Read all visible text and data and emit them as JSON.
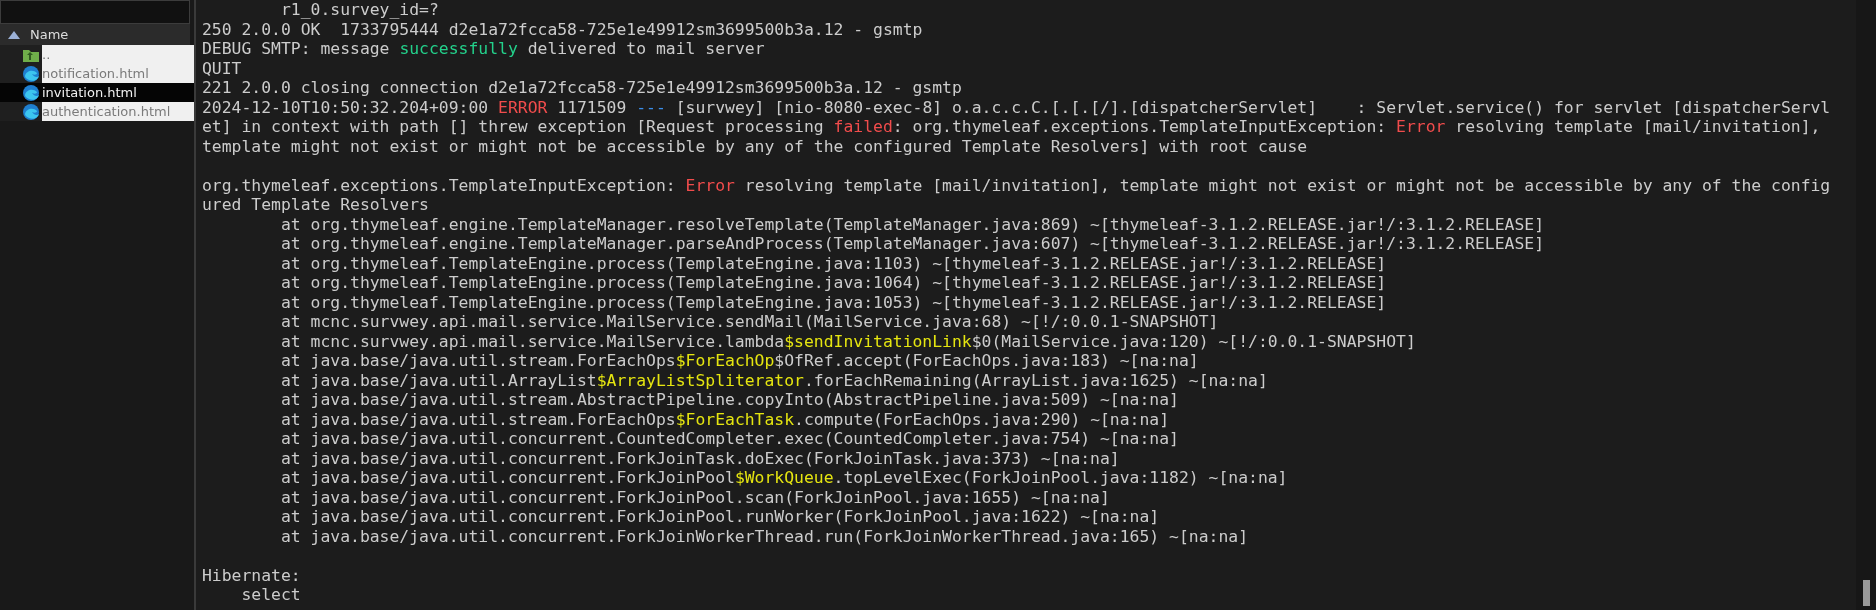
{
  "file_panel": {
    "column_header": "Name",
    "sort_ascending": true,
    "rows": [
      {
        "name": "..",
        "kind": "parent",
        "selected": false,
        "masked": true
      },
      {
        "name": "notification.html",
        "kind": "html",
        "selected": false,
        "masked": true
      },
      {
        "name": "invitation.html",
        "kind": "html",
        "selected": true,
        "masked": false
      },
      {
        "name": "authentication.html",
        "kind": "html",
        "selected": false,
        "masked": true
      }
    ]
  },
  "console": {
    "lines": [
      {
        "segments": [
          {
            "text": "        r1_0.survey_id=?",
            "kind": "plain"
          }
        ]
      },
      {
        "segments": [
          {
            "text": "250 2.0.0 OK  1733795444 d2e1a72fcca58-725e1e49912sm3699500b3a.12 - gsmtp",
            "kind": "plain"
          }
        ]
      },
      {
        "segments": [
          {
            "text": "DEBUG SMTP: message ",
            "kind": "plain"
          },
          {
            "text": "successfully",
            "kind": "success"
          },
          {
            "text": " delivered to mail server",
            "kind": "plain"
          }
        ]
      },
      {
        "segments": [
          {
            "text": "QUIT",
            "kind": "plain"
          }
        ]
      },
      {
        "segments": [
          {
            "text": "221 2.0.0 closing connection d2e1a72fcca58-725e1e49912sm3699500b3a.12 - gsmtp",
            "kind": "plain"
          }
        ]
      },
      {
        "segments": [
          {
            "text": "2024-12-10T10:50:32.204+09:00 ",
            "kind": "plain"
          },
          {
            "text": "ERROR",
            "kind": "error"
          },
          {
            "text": " 1171509 ",
            "kind": "plain"
          },
          {
            "text": "---",
            "kind": "muted"
          },
          {
            "text": " [survwey] [nio-8080-exec-8] o.a.c.c.C.[.[.[/].[dispatcherServlet]    : Servlet.service() for servlet [dispatcherServl",
            "kind": "plain"
          }
        ]
      },
      {
        "segments": [
          {
            "text": "et] in context with path [] threw exception [Request processing ",
            "kind": "plain"
          },
          {
            "text": "failed",
            "kind": "error"
          },
          {
            "text": ": org.thymeleaf.exceptions.TemplateInputException: ",
            "kind": "plain"
          },
          {
            "text": "Error",
            "kind": "error"
          },
          {
            "text": " resolving template [mail/invitation],",
            "kind": "plain"
          }
        ]
      },
      {
        "segments": [
          {
            "text": "template might not exist or might not be accessible by any of the configured Template Resolvers] with root cause",
            "kind": "plain"
          }
        ]
      },
      {
        "space_before": true,
        "segments": [
          {
            "text": "org.thymeleaf.exceptions.TemplateInputException: ",
            "kind": "plain"
          },
          {
            "text": "Error",
            "kind": "error"
          },
          {
            "text": " resolving template [mail/invitation], template might not exist or might not be accessible by any of the config",
            "kind": "plain"
          }
        ]
      },
      {
        "segments": [
          {
            "text": "ured Template Resolvers",
            "kind": "plain"
          }
        ]
      },
      {
        "segments": [
          {
            "text": "        at org.thymeleaf.engine.TemplateManager.resolveTemplate(TemplateManager.java:869) ~[thymeleaf-3.1.2.RELEASE.jar!/:3.1.2.RELEASE]",
            "kind": "plain"
          }
        ]
      },
      {
        "segments": [
          {
            "text": "        at org.thymeleaf.engine.TemplateManager.parseAndProcess(TemplateManager.java:607) ~[thymeleaf-3.1.2.RELEASE.jar!/:3.1.2.RELEASE]",
            "kind": "plain"
          }
        ]
      },
      {
        "segments": [
          {
            "text": "        at org.thymeleaf.TemplateEngine.process(TemplateEngine.java:1103) ~[thymeleaf-3.1.2.RELEASE.jar!/:3.1.2.RELEASE]",
            "kind": "plain"
          }
        ]
      },
      {
        "segments": [
          {
            "text": "        at org.thymeleaf.TemplateEngine.process(TemplateEngine.java:1064) ~[thymeleaf-3.1.2.RELEASE.jar!/:3.1.2.RELEASE]",
            "kind": "plain"
          }
        ]
      },
      {
        "segments": [
          {
            "text": "        at org.thymeleaf.TemplateEngine.process(TemplateEngine.java:1053) ~[thymeleaf-3.1.2.RELEASE.jar!/:3.1.2.RELEASE]",
            "kind": "plain"
          }
        ]
      },
      {
        "segments": [
          {
            "text": "        at mcnc.survwey.api.mail.service.MailService.sendMail(MailService.java:68) ~[!/:0.0.1-SNAPSHOT]",
            "kind": "plain"
          }
        ]
      },
      {
        "segments": [
          {
            "text": "        at mcnc.survwey.api.mail.service.MailService.lambda",
            "kind": "plain"
          },
          {
            "text": "$sendInvitationLink",
            "kind": "highlight"
          },
          {
            "text": "$0(MailService.java:120) ~[!/:0.0.1-SNAPSHOT]",
            "kind": "plain"
          }
        ]
      },
      {
        "segments": [
          {
            "text": "        at java.base/java.util.stream.ForEachOps",
            "kind": "plain"
          },
          {
            "text": "$ForEachOp",
            "kind": "highlight"
          },
          {
            "text": "$OfRef.accept(ForEachOps.java:183) ~[na:na]",
            "kind": "plain"
          }
        ]
      },
      {
        "segments": [
          {
            "text": "        at java.base/java.util.ArrayList",
            "kind": "plain"
          },
          {
            "text": "$ArrayListSpliterator",
            "kind": "highlight"
          },
          {
            "text": ".forEachRemaining(ArrayList.java:1625) ~[na:na]",
            "kind": "plain"
          }
        ]
      },
      {
        "segments": [
          {
            "text": "        at java.base/java.util.stream.AbstractPipeline.copyInto(AbstractPipeline.java:509) ~[na:na]",
            "kind": "plain"
          }
        ]
      },
      {
        "segments": [
          {
            "text": "        at java.base/java.util.stream.ForEachOps",
            "kind": "plain"
          },
          {
            "text": "$ForEachTask",
            "kind": "highlight"
          },
          {
            "text": ".compute(ForEachOps.java:290) ~[na:na]",
            "kind": "plain"
          }
        ]
      },
      {
        "segments": [
          {
            "text": "        at java.base/java.util.concurrent.CountedCompleter.exec(CountedCompleter.java:754) ~[na:na]",
            "kind": "plain"
          }
        ]
      },
      {
        "segments": [
          {
            "text": "        at java.base/java.util.concurrent.ForkJoinTask.doExec(ForkJoinTask.java:373) ~[na:na]",
            "kind": "plain"
          }
        ]
      },
      {
        "segments": [
          {
            "text": "        at java.base/java.util.concurrent.ForkJoinPool",
            "kind": "plain"
          },
          {
            "text": "$WorkQueue",
            "kind": "highlight"
          },
          {
            "text": ".topLevelExec(ForkJoinPool.java:1182) ~[na:na]",
            "kind": "plain"
          }
        ]
      },
      {
        "segments": [
          {
            "text": "        at java.base/java.util.concurrent.ForkJoinPool.scan(ForkJoinPool.java:1655) ~[na:na]",
            "kind": "plain"
          }
        ]
      },
      {
        "segments": [
          {
            "text": "        at java.base/java.util.concurrent.ForkJoinPool.runWorker(ForkJoinPool.java:1622) ~[na:na]",
            "kind": "plain"
          }
        ]
      },
      {
        "segments": [
          {
            "text": "        at java.base/java.util.concurrent.ForkJoinWorkerThread.run(ForkJoinWorkerThread.java:165) ~[na:na]",
            "kind": "plain"
          }
        ]
      },
      {
        "space_before": true,
        "segments": [
          {
            "text": "Hibernate:",
            "kind": "plain"
          }
        ]
      },
      {
        "segments": [
          {
            "text": "    select",
            "kind": "plain"
          }
        ]
      }
    ]
  }
}
